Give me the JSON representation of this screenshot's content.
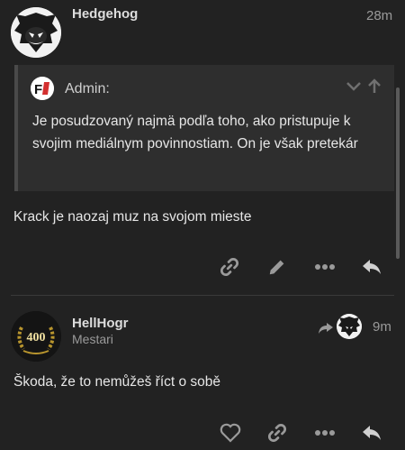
{
  "post1": {
    "username": "Hedgehog",
    "time": "28m",
    "quote": {
      "author": "Admin:",
      "avatar_letters": "F1",
      "text": "Je posudzovaný najmä podľa toho, ako pristupuje k svojim mediálnym povinnostiam. On je však pretekár"
    },
    "body": "Krack je naozaj muz na svojom mieste"
  },
  "post2": {
    "username": "HellHogr",
    "title": "Mestari",
    "badge_number": "400",
    "time": "9m",
    "body": "Škoda, že to nemůžeš říct o sobě"
  },
  "icons": {
    "link": "link-icon",
    "edit": "pencil-icon",
    "more": "more-dots-icon",
    "reply": "reply-icon",
    "like": "heart-icon",
    "expand": "chevron-down-icon",
    "collapse": "arrow-up-icon"
  },
  "colors": {
    "background": "#222222",
    "quote_background": "#2e2e2e",
    "text": "#e6e6e6",
    "muted": "#9a9a9a",
    "admin_badge_red": "#d32f2f"
  }
}
